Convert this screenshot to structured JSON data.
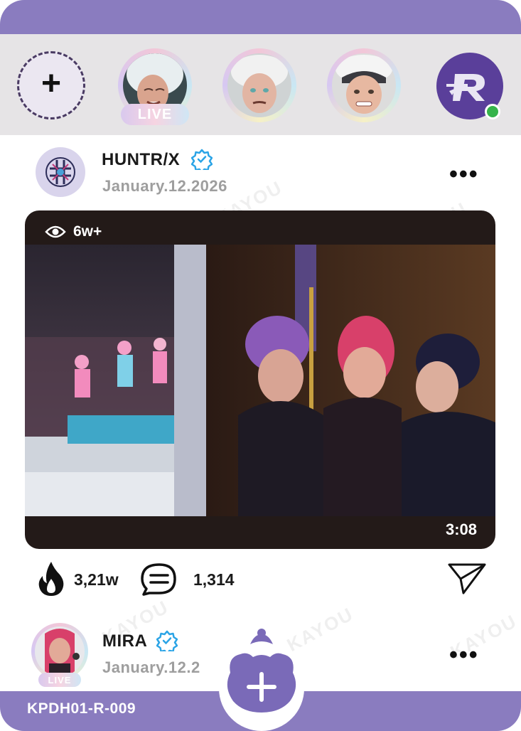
{
  "stories": {
    "add_icon": "plus-icon",
    "live_label": "LIVE"
  },
  "post": {
    "username": "HUNTR/X",
    "date": "January.12.2026",
    "more_icon": "•••",
    "video": {
      "views": "6w+",
      "duration": "3:08"
    },
    "likes": "3,21w",
    "comments": "1,314"
  },
  "next_post": {
    "username": "MIRA",
    "date": "January.12.2",
    "live_label": "LIVE",
    "more_icon": "•••"
  },
  "footer": {
    "card_code": "KPDH01-R-009",
    "add_icon": "+"
  },
  "colors": {
    "accent": "#8a7cbf",
    "brand_avatar": "#5a3f9a",
    "verified": "#2ba4e6",
    "online": "#35b34a"
  },
  "watermark_text": "KAYOU"
}
